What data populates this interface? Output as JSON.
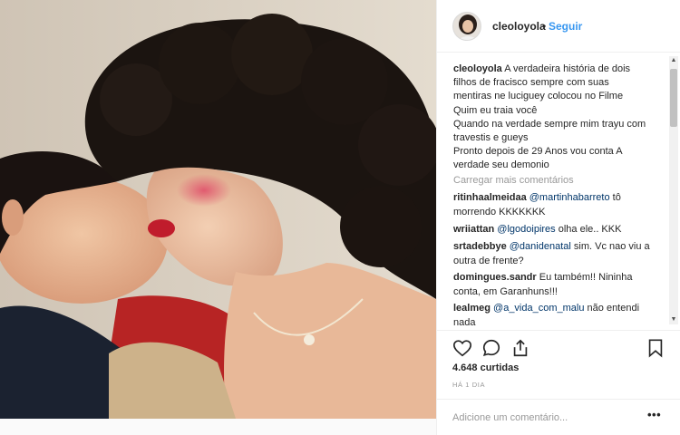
{
  "post": {
    "username": "cleoloyola",
    "dot": "•",
    "follow_label": "Seguir"
  },
  "caption": {
    "username": "cleoloyola",
    "lines": [
      "A verdadeira história de dois",
      "filhos de fracisco sempre com suas",
      "mentiras ne luciguey colocou no Filme",
      "Quim eu traia você",
      "Quando na verdade sempre mim trayu com",
      "travestis e gueys",
      "Pronto depois de 29 Anos vou conta A",
      "verdade seu demonio"
    ]
  },
  "load_more_label": "Carregar mais comentários",
  "comments": [
    {
      "username": "ritinhaalmeidaa",
      "mention": "@martinhabarreto",
      "text": " tô",
      "text2": "morrendo KKKKKKK"
    },
    {
      "username": "wriiattan",
      "mention": "@lgodoipires",
      "text": " olha ele.. KKK",
      "text2": ""
    },
    {
      "username": "srtadebbye",
      "mention": "@danidenatal",
      "text": " sim. Vc nao viu a",
      "text2": "outra de frente?"
    },
    {
      "username": "domingues.sandr",
      "mention": "",
      "text": "Eu também!! Nininha",
      "text2": "conta, em Garanhuns!!!"
    },
    {
      "username": "lealmeg",
      "mention": "@a_vida_com_malu",
      "text": " não entendi",
      "text2": "nada"
    }
  ],
  "actions": {
    "like_icon": "heart-outline",
    "comment_icon": "speech-bubble",
    "share_icon": "share-arrow",
    "save_icon": "bookmark-outline"
  },
  "likes_label": "4.648 curtidas",
  "time_label": "HÁ 1 DIA",
  "add_comment": {
    "placeholder": "Adicione um comentário...",
    "more_label": "•••"
  },
  "colors": {
    "link": "#3897f0",
    "mention": "#003569",
    "muted": "#999999",
    "border": "#efefef"
  }
}
